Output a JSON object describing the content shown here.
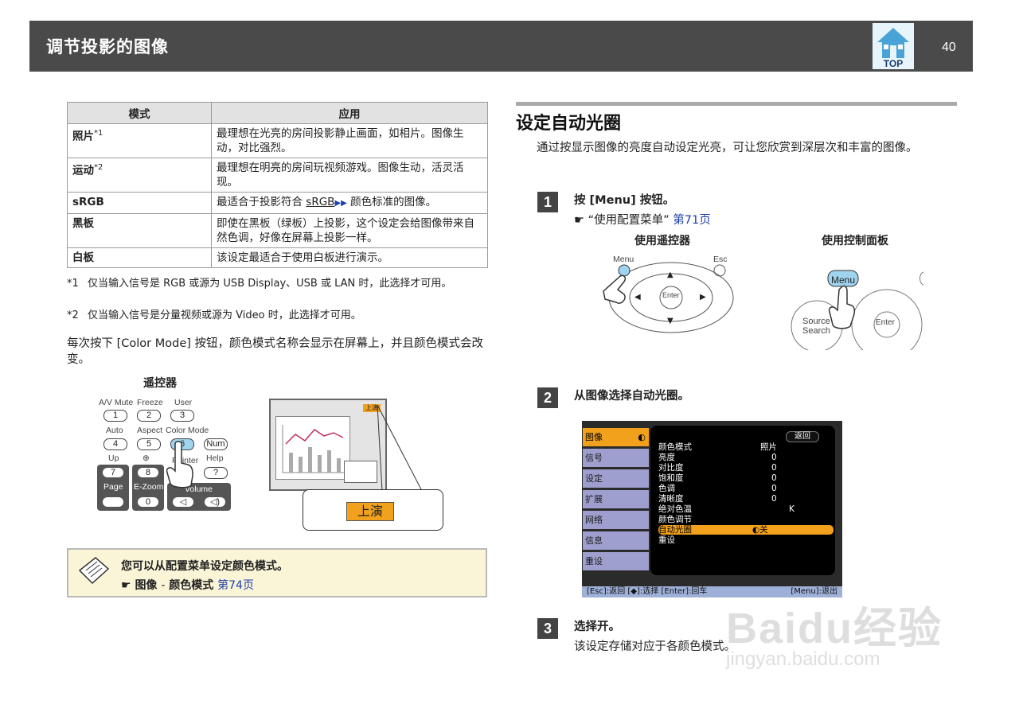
{
  "header": {
    "title": "调节投影的图像",
    "top_label": "TOP",
    "page_number": "40"
  },
  "mode_table": {
    "headers": [
      "模式",
      "应用"
    ],
    "rows": [
      {
        "name": "照片",
        "mark": "*1",
        "desc": "最理想在光亮的房间投影静止画面，如相片。图像生动，对比强烈。"
      },
      {
        "name": "运动",
        "mark": "*2",
        "desc": "最理想在明亮的房间玩视频游戏。图像生动，活灵活现。"
      },
      {
        "name": "sRGB",
        "mark": "",
        "desc_pre": "最适合于投影符合 ",
        "desc_link": "sRGB",
        "desc_post": " 颜色标准的图像。"
      },
      {
        "name": "黑板",
        "mark": "",
        "desc": "即使在黑板（绿板）上投影，这个设定会给图像带来自然色调，好像在屏幕上投影一样。"
      },
      {
        "name": "白板",
        "mark": "",
        "desc": "该设定最适合于使用白板进行演示。"
      }
    ]
  },
  "footnotes": [
    {
      "mark": "*1",
      "text": "仅当输入信号是 RGB 或源为 USB Display、USB 或 LAN 时，此选择才可用。"
    },
    {
      "mark": "*2",
      "text": "仅当输入信号是分量视频或源为 Video 时，此选择才可用。"
    }
  ],
  "color_mode_para": "每次按下 [Color Mode] 按钮，颜色模式名称会显示在屏幕上，并且颜色模式会改变。",
  "remote_section": {
    "label": "遥控器",
    "top_labels": [
      "A/V Mute",
      "Freeze",
      "User"
    ],
    "row1": [
      "1",
      "2",
      "3"
    ],
    "mid_labels": [
      "Auto",
      "Aspect",
      "Color Mode"
    ],
    "row2": [
      "4",
      "5",
      "6",
      "Num"
    ],
    "low_labels": [
      "Up",
      "⊕",
      "Pointer",
      "Help"
    ],
    "row3": [
      "7",
      "8",
      "?"
    ],
    "bottom_labels": [
      "Page",
      "E-Zoom",
      "Volume"
    ],
    "row4": [
      "0"
    ],
    "screen_badge": "上演",
    "callout_badge": "上演"
  },
  "tip": {
    "text": "您可以从配置菜单设定颜色模式。",
    "ref_item": "图像",
    "ref_sep": "-",
    "ref_sub": "颜色模式",
    "ref_page": "第74页"
  },
  "section": {
    "title": "设定自动光圈",
    "intro": "通过按显示图像的亮度自动设定光亮，可让您欣赏到深层次和丰富的图像。"
  },
  "steps": [
    {
      "num": "1",
      "text": "按 [Menu] 按钮。",
      "ref": "“使用配置菜单”",
      "ref_page": "第71页"
    },
    {
      "num": "2",
      "text": "从图像选择自动光圈。"
    },
    {
      "num": "3",
      "text": "选择开。",
      "sub": "该设定存储对应于各颜色模式。"
    }
  ],
  "step1_figures": {
    "remote_label": "使用遥控器",
    "panel_label": "使用控制面板",
    "remote": {
      "menu": "Menu",
      "esc": "Esc",
      "enter": "Enter"
    },
    "panel": {
      "menu": "Menu",
      "source": "Source",
      "search": "Search",
      "enter": "Enter"
    }
  },
  "menu_screen": {
    "tabs": [
      "图像",
      "信号",
      "设定",
      "扩展",
      "网络",
      "信息",
      "重设"
    ],
    "back": "返回",
    "rows": [
      {
        "label": "颜色模式",
        "value": "照片"
      },
      {
        "label": "亮度",
        "value": "0"
      },
      {
        "label": "对比度",
        "value": "0"
      },
      {
        "label": "饱和度",
        "value": "0"
      },
      {
        "label": "色调",
        "value": "0"
      },
      {
        "label": "清晰度",
        "value": "0"
      },
      {
        "label": "绝对色温",
        "value": "K"
      },
      {
        "label": "颜色调节",
        "value": ""
      },
      {
        "label": "自动光圈",
        "value": "◐关"
      },
      {
        "label": "重设",
        "value": ""
      }
    ],
    "footer": "[Esc]:返回 [◆]:选择 [Enter]:回车",
    "footer_right": "[Menu]:退出"
  },
  "watermark": {
    "line1": "Baidu经验",
    "line2": "jingyan.baidu.com"
  }
}
